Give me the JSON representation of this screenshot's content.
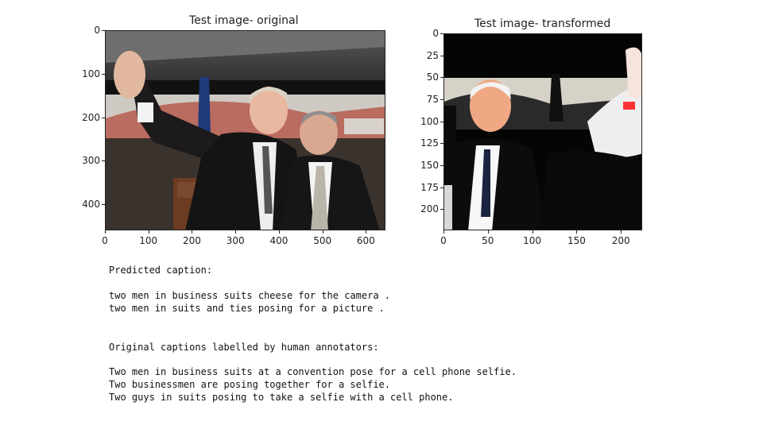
{
  "figures": {
    "left": {
      "title": "Test image- original",
      "x_ticks": [
        0,
        100,
        200,
        300,
        400,
        500,
        600
      ],
      "y_ticks": [
        0,
        100,
        200,
        300,
        400
      ],
      "x_range": [
        0,
        645
      ],
      "y_range": [
        0,
        460
      ]
    },
    "right": {
      "title": "Test image- transformed",
      "x_ticks": [
        0,
        50,
        100,
        150,
        200
      ],
      "y_ticks": [
        0,
        25,
        50,
        75,
        100,
        125,
        150,
        175,
        200
      ],
      "x_range": [
        0,
        224
      ],
      "y_range": [
        0,
        224
      ]
    }
  },
  "captions": {
    "predicted_header": "Predicted caption:",
    "predicted": [
      "two men in business suits cheese for the camera .",
      "two men in suits and ties posing for a picture ."
    ],
    "original_header": "Original captions labelled by human annotators:",
    "original": [
      "Two men in business suits at a convention pose for a cell phone selfie.",
      "Two businessmen are posing together for a selfie.",
      "Two guys in suits posing to take a selfie with a cell phone."
    ]
  }
}
